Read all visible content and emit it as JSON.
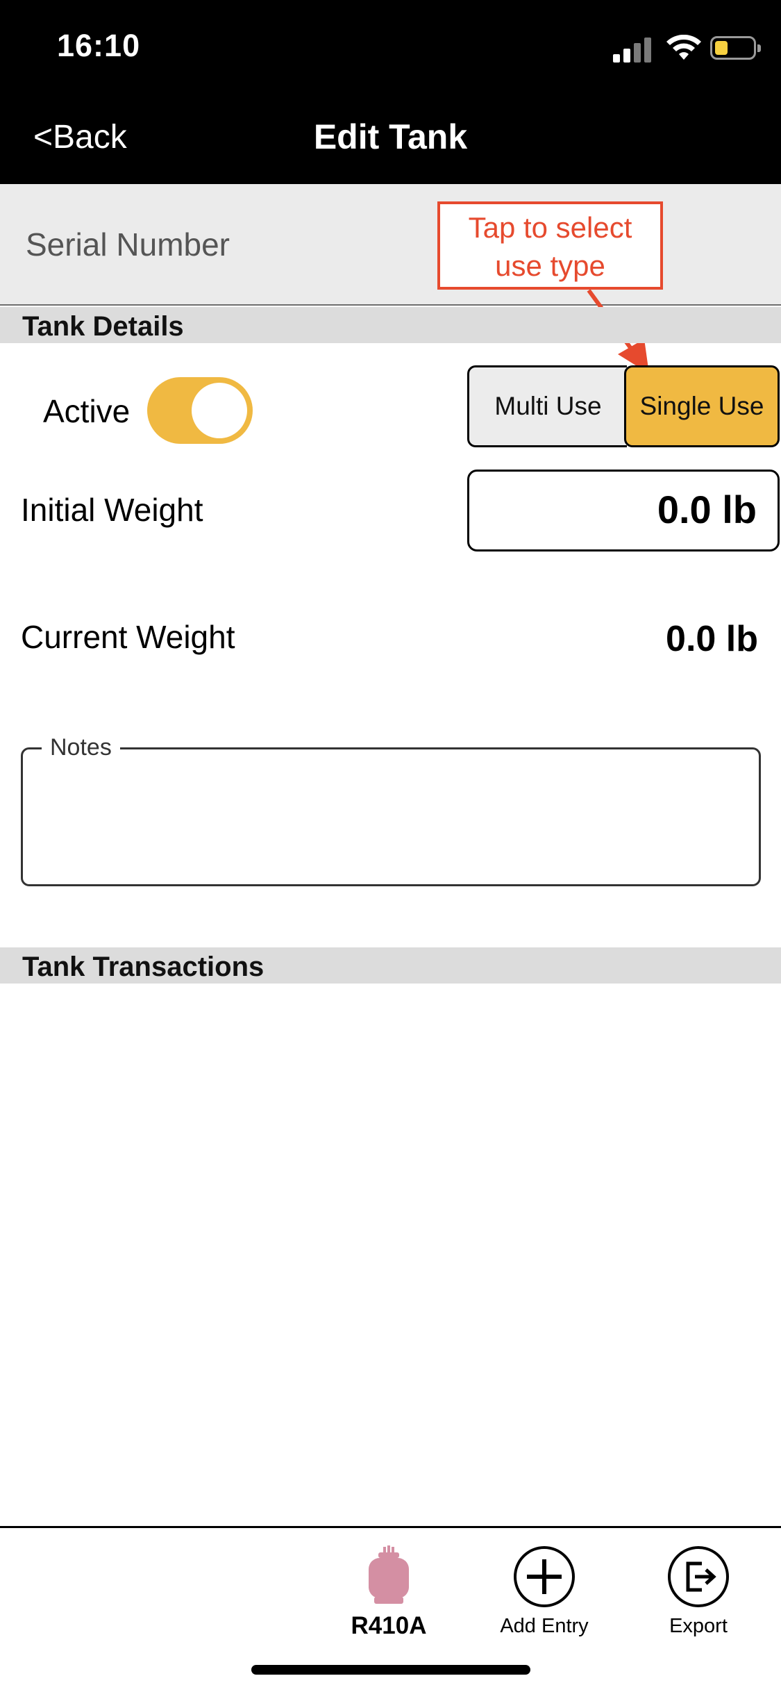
{
  "status_bar": {
    "time": "16:10",
    "icons": [
      "cellular-signal-icon",
      "wifi-icon",
      "battery-icon"
    ]
  },
  "nav": {
    "back_label": "<Back",
    "title": "Edit Tank"
  },
  "serial": {
    "placeholder": "Serial Number",
    "value": ""
  },
  "annotation": {
    "text_line1": "Tap to select",
    "text_line2": "use type",
    "color": "#e64a2e"
  },
  "tank_details": {
    "header": "Tank Details",
    "active_label": "Active",
    "active_on": true,
    "use_type_options": [
      "Multi Use",
      "Single Use"
    ],
    "use_type_selected": "Single Use",
    "initial_weight_label": "Initial Weight",
    "initial_weight_value": "0.0 lb",
    "current_weight_label": "Current Weight",
    "current_weight_value": "0.0 lb",
    "notes_label": "Notes",
    "notes_value": ""
  },
  "transactions": {
    "header": "Tank Transactions",
    "items": []
  },
  "tabbar": {
    "items": [
      {
        "label": "R410A",
        "icon": "refrigerant-tank-icon",
        "icon_color": "#d48fa3"
      },
      {
        "label": "Add Entry",
        "icon": "plus-circle-icon"
      },
      {
        "label": "Export",
        "icon": "export-icon"
      }
    ]
  },
  "colors": {
    "accent": "#f0b942",
    "nav_background": "#000000",
    "section_header": "#dcdcdc"
  }
}
